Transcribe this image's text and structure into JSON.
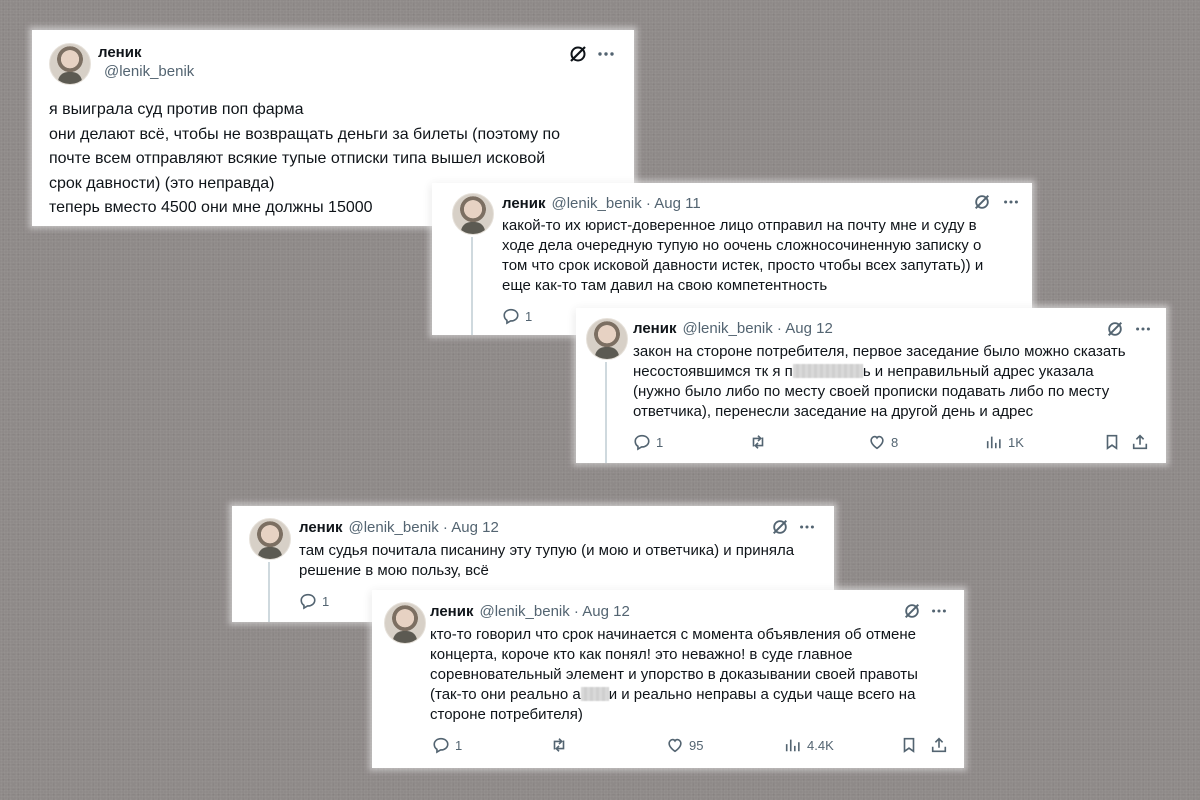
{
  "author": {
    "name": "леник",
    "handle": "@lenik_benik"
  },
  "tweets": [
    {
      "handle": "@lenik_benik",
      "lines": [
        "я выиграла суд против поп фарма",
        "они делают всё, чтобы не возвращать деньги за билеты (поэтому по",
        "почте всем отправляют всякие тупые отписки типа вышел исковой",
        "срок давности) (это неправда)",
        "теперь вместо 4500 они мне должны 15000"
      ]
    },
    {
      "handle_date": "@lenik_benik · Aug 11",
      "lines": [
        "какой-то их юрист-доверенное лицо отправил на почту мне и суду в",
        "ходе дела очередную тупую но оочень сложносочиненную записку о",
        "том что срок исковой давности истек, просто чтобы всех запутать)) и",
        "еще как-то там давил на свою компетентность"
      ],
      "replies": "1"
    },
    {
      "handle_date": "@lenik_benik · Aug 12",
      "lines": [
        "закон на стороне потребителя, первое заседание было можно сказать",
        "несостоявшимся тк я п",
        "ь и неправильный адрес указала",
        "(нужно было либо по месту своей прописки подавать либо по месту",
        "ответчика), перенесли заседание на другой день и адрес"
      ],
      "replies": "1",
      "likes": "8",
      "views": "1K"
    },
    {
      "handle_date": "@lenik_benik · Aug 12",
      "lines": [
        "там судья почитала писанину эту тупую (и мою и ответчика) и приняла",
        "решение в мою пользу, всё"
      ],
      "replies": "1"
    },
    {
      "handle_date": "@lenik_benik · Aug 12",
      "lines": [
        "кто-то говорил что срок начинается с момента объявления об отмене",
        "концерта, короче кто как понял! это неважно! в суде главное",
        "соревновательный элемент и упорство в доказывании своей правоты",
        "(так-то они реально а",
        "и и реально неправы а судьи чаще всего на",
        "стороне потребителя)"
      ],
      "replies": "1",
      "likes": "95",
      "views": "4.4K"
    }
  ],
  "icons": {
    "grok": "grok-icon",
    "more": "more-icon",
    "reply": "reply-icon",
    "retweet": "retweet-icon",
    "like": "heart-icon",
    "views": "views-icon",
    "bookmark": "bookmark-icon",
    "share": "share-icon"
  },
  "colors": {
    "background": "#8f8a89",
    "card": "#ffffff",
    "text": "#0f1419",
    "secondary": "#536471",
    "thread_line": "#cfd9de"
  }
}
